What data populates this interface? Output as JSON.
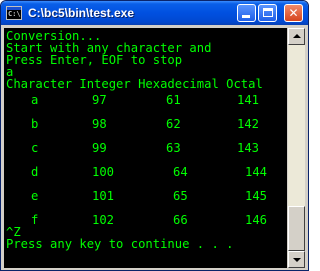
{
  "window": {
    "title": "C:\\bc5\\bin\\test.exe",
    "icon": "console-app-icon",
    "icon_text": "C:\\",
    "controls": {
      "minimize_icon": "minimize-icon",
      "maximize_icon": "maximize-icon",
      "close_icon": "close-icon",
      "close_glyph": "✕"
    }
  },
  "console": {
    "text_color": "#00ff00",
    "background": "#000000",
    "lines": [
      "Conversion...",
      "Start with any character and",
      "Press Enter, EOF to stop",
      "a",
      "Character Integer Hexadecimal Octal"
    ],
    "rows": [
      {
        "char": "a",
        "int": "97",
        "hex": "61",
        "oct": "141"
      },
      {
        "char": "b",
        "int": "98",
        "hex": "62",
        "oct": "142"
      },
      {
        "char": "c",
        "int": "99",
        "hex": "63",
        "oct": "143"
      },
      {
        "char": "d",
        "int": "100",
        "hex": "64",
        "oct": "144"
      },
      {
        "char": "e",
        "int": "101",
        "hex": "65",
        "oct": "145"
      },
      {
        "char": "f",
        "int": "102",
        "hex": "66",
        "oct": "146"
      }
    ],
    "eof_line": "^Z",
    "continue_line": "Press any key to continue . . ."
  },
  "scrollbar": {
    "up_icon": "scroll-up-arrow-icon",
    "down_icon": "scroll-down-arrow-icon"
  }
}
